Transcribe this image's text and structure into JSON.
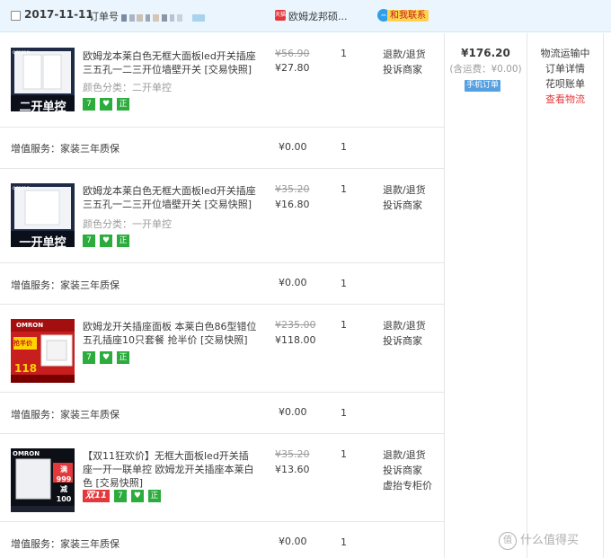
{
  "header": {
    "date": "2017-11-11",
    "order_label": "订单号",
    "shop_badge": "天猫",
    "shop_name": "欧姆龙邦硕...",
    "contact_label": "和我联系"
  },
  "items": [
    {
      "thumb_brand": "omron",
      "thumb_caption": "二开单控",
      "title": "欧姆龙本莱白色无框大面板led开关插座三五孔一二三开位墙壁开关 [交易快照]",
      "variant": "颜色分类：二开单控",
      "orig_price": "¥56.90",
      "price": "¥27.80",
      "qty": "1",
      "actions": [
        "退款/退货",
        "投诉商家"
      ]
    },
    {
      "thumb_brand": "omron",
      "thumb_caption": "一开单控",
      "title": "欧姆龙本莱白色无框大面板led开关插座三五孔一二三开位墙壁开关 [交易快照]",
      "variant": "颜色分类：一开单控",
      "orig_price": "¥35.20",
      "price": "¥16.80",
      "qty": "1",
      "actions": [
        "退款/退货",
        "投诉商家"
      ]
    },
    {
      "thumb_brand": "OMRON",
      "thumb_caption": "抢半价",
      "thumb_number": "118",
      "title": "欧姆龙开关插座面板 本莱白色86型错位五孔插座10只套餐 抢半价 [交易快照]",
      "variant": "",
      "orig_price": "¥235.00",
      "price": "¥118.00",
      "qty": "1",
      "actions": [
        "退款/退货",
        "投诉商家"
      ]
    },
    {
      "thumb_brand": "OMRON",
      "thumb_caption": "满999减100",
      "title": "【双11狂欢价】无框大面板led开关插座一开一联单控 欧姆龙开关插座本莱白色 [交易快照]",
      "variant": "",
      "sale_badge": "双11",
      "orig_price": "¥35.20",
      "price": "¥13.60",
      "qty": "1",
      "actions": [
        "退款/退货",
        "投诉商家",
        "虚抬专柜价"
      ]
    }
  ],
  "badges": {
    "seven_day": "7",
    "shield": "♥",
    "genuine": "正"
  },
  "service": {
    "label": "增值服务：家装三年质保",
    "price": "¥0.00",
    "qty": "1"
  },
  "order_total": {
    "amount": "¥176.20",
    "shipping": "(含运费：¥0.00)",
    "mobile_label": "手机订单"
  },
  "status": {
    "line1": "物流运输中",
    "line2": "订单详情",
    "line3": "花呗账单",
    "line4": "查看物流"
  },
  "watermark": {
    "icon_text": "值",
    "text": "什么值得买"
  },
  "colors": {
    "accent_blue": "#55a0e1",
    "link_red": "#e4393c",
    "header_bg": "#eaf5fd",
    "badge_green": "#2bac3c"
  }
}
